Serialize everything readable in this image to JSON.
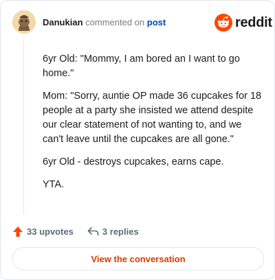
{
  "comment": {
    "username": "Danukian",
    "action_text": "commented on",
    "target_link": "post",
    "avatar_icon": "snoo-avatar-icon",
    "paragraphs": [
      "6yr Old: \"Mommy, I am bored an I want to go home.\"",
      "Mom: \"Sorry, auntie OP made 36 cupcakes for 18 people at a party she insisted we attend despite our clear statement of not wanting to, and we can't leave until the cupcakes are all gone.\"",
      "6yr Old - destroys cupcakes, earns cape.",
      "YTA."
    ]
  },
  "brand": {
    "name": "reddit",
    "logo_icon": "reddit-alien-icon",
    "accent_color": "#ff4500"
  },
  "actions": {
    "upvotes_label": "33 upvotes",
    "replies_label": "3 replies",
    "upvote_icon": "upvote-arrow-icon",
    "reply_icon": "reply-arrow-icon"
  },
  "cta": {
    "label": "View the conversation",
    "color": "#d93a00"
  }
}
